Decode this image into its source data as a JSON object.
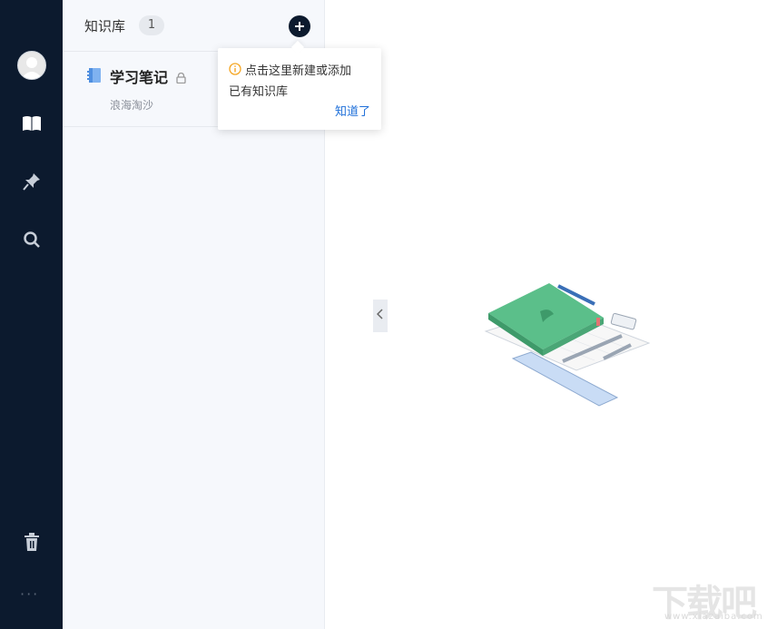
{
  "sidebar": {
    "icons": [
      "avatar",
      "book-icon",
      "pin-icon",
      "search-icon",
      "trash-icon"
    ],
    "more_label": "···"
  },
  "panel": {
    "title": "知识库",
    "count": "1",
    "add_icon": "plus-icon",
    "items": [
      {
        "name": "学习笔记",
        "owner": "浪海淘沙",
        "icon": "notebook-icon",
        "private": true
      }
    ],
    "collapse_icon": "chevron-left-icon"
  },
  "tooltip": {
    "message_line1": "点击这里新建或添加",
    "message_line2": "已有知识库",
    "confirm_label": "知道了",
    "icon": "info-icon"
  },
  "colors": {
    "nav_bg": "#0c1a2e",
    "panel_bg": "#f6f8fc",
    "link": "#1e6fd9",
    "warn": "#f5a623"
  },
  "watermark": {
    "text": "下载吧",
    "subtext": "www.xiazaiba.com"
  }
}
